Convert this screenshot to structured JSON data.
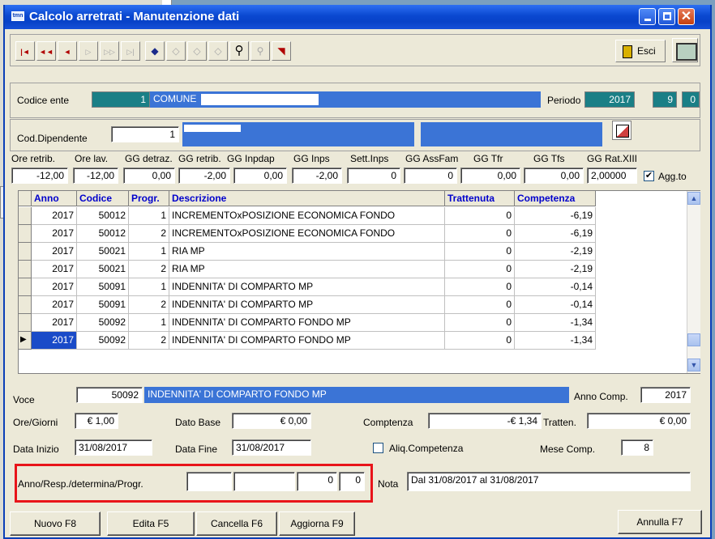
{
  "window": {
    "title": "Calcolo arretrati - Manutenzione dati",
    "icon_text": "tmn",
    "controls": [
      "minimize",
      "maximize",
      "close"
    ]
  },
  "toolbar": {
    "nav": [
      "|◄",
      "◄◄",
      "◄",
      "▷",
      "▷▷",
      "▷|"
    ],
    "actions": [
      "add-record",
      "edit-record",
      "edit-multi",
      "delete-record",
      "search",
      "find-person",
      "filter"
    ],
    "esci_label": "Esci"
  },
  "header": {
    "codice_ente_label": "Codice ente",
    "codice_ente_value": "1",
    "ente_name": "COMUNE",
    "periodo_label": "Periodo",
    "periodo_anno": "2017",
    "periodo_mese": "9",
    "periodo_extra": "0"
  },
  "dipendente": {
    "label": "Cod.Dipendente",
    "value": "1"
  },
  "totals": {
    "headers": [
      "Ore retrib.",
      "Ore lav.",
      "GG detraz.",
      "GG retrib.",
      "GG Inpdap",
      "GG Inps",
      "Sett.Inps",
      "GG AssFam",
      "GG Tfr",
      "GG Tfs",
      "GG Rat.XIII"
    ],
    "values": [
      "-12,00",
      "-12,00",
      "0,00",
      "-2,00",
      "0,00",
      "-2,00",
      "0",
      "0",
      "0,00",
      "0,00",
      "2,00000"
    ],
    "agg_label": "Agg.to",
    "agg_checked": true
  },
  "grid": {
    "columns": [
      "Anno",
      "Codice",
      "Progr.",
      "Descrizione",
      "Trattenuta",
      "Competenza"
    ],
    "rows": [
      [
        "2017",
        "50012",
        "1",
        "INCREMENTOxPOSIZIONE ECONOMICA FONDO",
        "0",
        "-6,19"
      ],
      [
        "2017",
        "50012",
        "2",
        "INCREMENTOxPOSIZIONE ECONOMICA FONDO",
        "0",
        "-6,19"
      ],
      [
        "2017",
        "50021",
        "1",
        "RIA MP",
        "0",
        "-2,19"
      ],
      [
        "2017",
        "50021",
        "2",
        "RIA MP",
        "0",
        "-2,19"
      ],
      [
        "2017",
        "50091",
        "1",
        "INDENNITA' DI COMPARTO MP",
        "0",
        "-0,14"
      ],
      [
        "2017",
        "50091",
        "2",
        "INDENNITA' DI COMPARTO MP",
        "0",
        "-0,14"
      ],
      [
        "2017",
        "50092",
        "1",
        "INDENNITA' DI COMPARTO FONDO MP",
        "0",
        "-1,34"
      ],
      [
        "2017",
        "50092",
        "2",
        "INDENNITA' DI COMPARTO FONDO MP",
        "0",
        "-1,34"
      ]
    ],
    "selected_row": 7
  },
  "detail": {
    "voce_label": "Voce",
    "voce_code": "50092",
    "voce_desc": "INDENNITA' DI COMPARTO FONDO MP",
    "anno_comp_label": "Anno Comp.",
    "anno_comp_value": "2017",
    "ore_label": "Ore/Giorni",
    "ore_value": "€ 1,00",
    "dato_base_label": "Dato Base",
    "dato_base_value": "€ 0,00",
    "competenza_label": "Comptenza",
    "competenza_value": "-€ 1,34",
    "tratten_label": "Tratten.",
    "tratten_value": "€ 0,00",
    "data_inizio_label": "Data Inizio",
    "data_inizio_value": "31/08/2017",
    "data_fine_label": "Data Fine",
    "data_fine_value": "31/08/2017",
    "aliq_label": "Aliq.Competenza",
    "mese_comp_label": "Mese Comp.",
    "mese_comp_value": "8",
    "anno_resp_label": "Anno/Resp./determina/Progr.",
    "anno_resp_values": [
      "",
      "",
      "0",
      "0"
    ],
    "nota_label": "Nota",
    "nota_value": "Dal 31/08/2017 al 31/08/2017"
  },
  "buttons": {
    "nuovo": "Nuovo F8",
    "edita": "Edita F5",
    "cancella": "Cancella F6",
    "aggiorna": "Aggiorna F9",
    "annulla": "Annulla F7"
  },
  "colors": {
    "title_blue": "#0a48d0",
    "field_blue": "#3b74d6",
    "teal": "#1a7f86",
    "header_text": "#0000cc",
    "highlight": "#e8141a"
  }
}
